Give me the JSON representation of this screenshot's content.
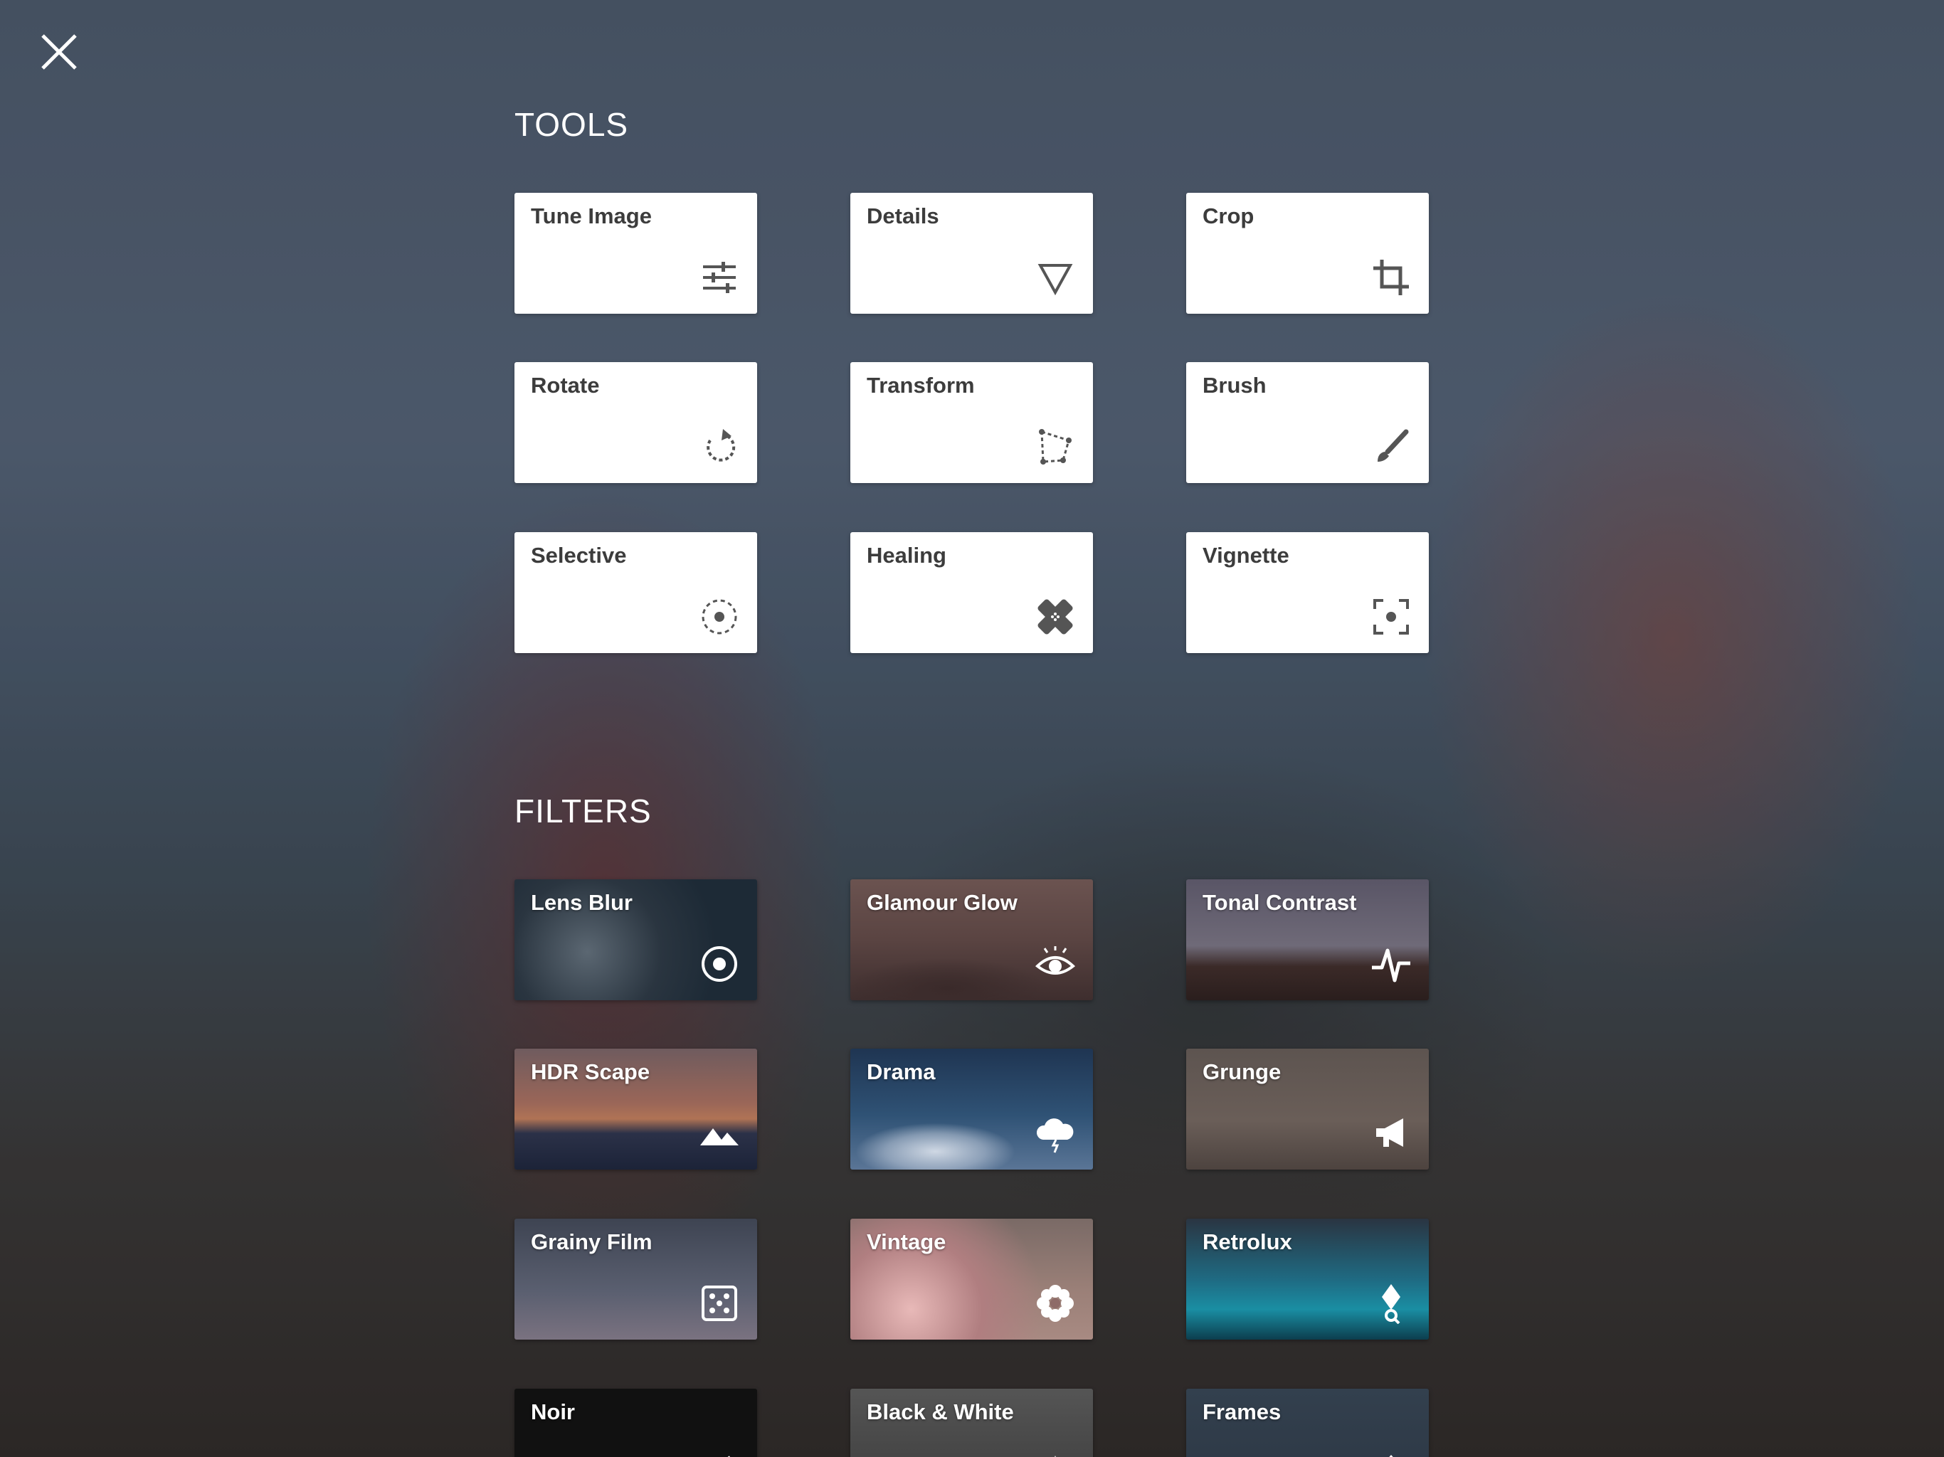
{
  "close": {
    "icon": "close-icon"
  },
  "tools": {
    "title": "TOOLS",
    "items": [
      {
        "label": "Tune Image",
        "icon": "sliders-icon"
      },
      {
        "label": "Details",
        "icon": "triangle-down-icon"
      },
      {
        "label": "Crop",
        "icon": "crop-icon"
      },
      {
        "label": "Rotate",
        "icon": "rotate-icon"
      },
      {
        "label": "Transform",
        "icon": "perspective-icon"
      },
      {
        "label": "Brush",
        "icon": "brush-icon"
      },
      {
        "label": "Selective",
        "icon": "selective-target-icon"
      },
      {
        "label": "Healing",
        "icon": "bandage-icon"
      },
      {
        "label": "Vignette",
        "icon": "vignette-focus-icon"
      }
    ]
  },
  "filters": {
    "title": "FILTERS",
    "items": [
      {
        "label": "Lens Blur",
        "icon": "lens-target-icon"
      },
      {
        "label": "Glamour Glow",
        "icon": "eye-icon"
      },
      {
        "label": "Tonal Contrast",
        "icon": "pulse-icon"
      },
      {
        "label": "HDR Scape",
        "icon": "mountains-icon"
      },
      {
        "label": "Drama",
        "icon": "storm-cloud-icon"
      },
      {
        "label": "Grunge",
        "icon": "megaphone-icon"
      },
      {
        "label": "Grainy Film",
        "icon": "dice-icon"
      },
      {
        "label": "Vintage",
        "icon": "flower-icon"
      },
      {
        "label": "Retrolux",
        "icon": "pin-icon"
      },
      {
        "label": "Noir",
        "icon": "noir-icon"
      },
      {
        "label": "Black & White",
        "icon": "bw-icon"
      },
      {
        "label": "Frames",
        "icon": "frames-icon"
      }
    ]
  }
}
